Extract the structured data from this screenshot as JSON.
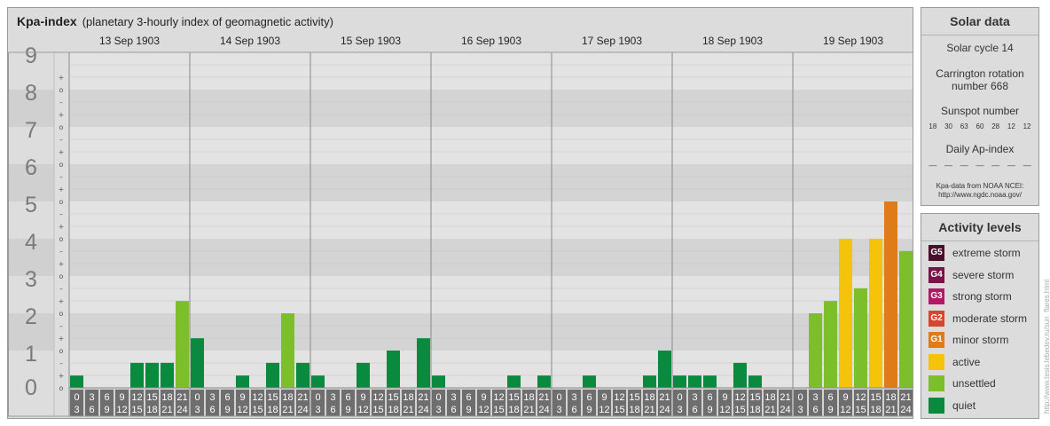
{
  "header": {
    "title": "Kpa-index",
    "subtitle": "(planetary 3-hourly index of geomagnetic activity)"
  },
  "chart_data": {
    "type": "bar",
    "title": "Kpa-index",
    "subtitle": "(planetary 3-hourly index of geomagnetic activity)",
    "ylim": [
      0,
      9
    ],
    "y_tick_labels": [
      "0",
      "1",
      "2",
      "3",
      "4",
      "5",
      "6",
      "7",
      "8",
      "9"
    ],
    "y_minor_labels": [
      "o",
      "+",
      "–"
    ],
    "days": [
      "13 Sep 1903",
      "14 Sep 1903",
      "15 Sep 1903",
      "16 Sep 1903",
      "17 Sep 1903",
      "18 Sep 1903",
      "19 Sep 1903"
    ],
    "interval_labels": [
      [
        "0",
        "3"
      ],
      [
        "3",
        "6"
      ],
      [
        "6",
        "9"
      ],
      [
        "9",
        "12"
      ],
      [
        "12",
        "15"
      ],
      [
        "15",
        "18"
      ],
      [
        "18",
        "21"
      ],
      [
        "21",
        "24"
      ]
    ],
    "values": [
      [
        0.33,
        0,
        0,
        0,
        0.67,
        0.67,
        0.67,
        2.33
      ],
      [
        1.33,
        0,
        0,
        0.33,
        0,
        0.67,
        2.0,
        0.67
      ],
      [
        0.33,
        0,
        0,
        0.67,
        0,
        1.0,
        0,
        1.33
      ],
      [
        0.33,
        0,
        0,
        0,
        0,
        0.33,
        0,
        0.33
      ],
      [
        0,
        0,
        0.33,
        0,
        0,
        0,
        0.33,
        1.0
      ],
      [
        0.33,
        0.33,
        0.33,
        0,
        0.67,
        0.33,
        0,
        0
      ],
      [
        0,
        2.0,
        2.33,
        4.0,
        2.67,
        4.0,
        5.0,
        3.67
      ]
    ],
    "colors": {
      "quiet": "#0a8a3e",
      "unsettled": "#7cbf2a",
      "active": "#f5c40a",
      "minor": "#e07b1a"
    }
  },
  "solar": {
    "heading": "Solar data",
    "cycle": "Solar cycle 14",
    "carrington_line1": "Carrington rotation",
    "carrington_line2": "number 668",
    "sunspot_heading": "Sunspot number",
    "sunspots": [
      "18",
      "30",
      "63",
      "60",
      "28",
      "12",
      "12"
    ],
    "ap_heading": "Daily Ap-index",
    "ap_values": [
      "—",
      "—",
      "—",
      "—",
      "—",
      "—",
      "—"
    ],
    "source_line1": "Kpa-data from NOAA NCEI:",
    "source_line2": "http://www.ngdc.noaa.gov/"
  },
  "activity": {
    "heading": "Activity levels",
    "levels": [
      {
        "badge": "G5",
        "label": "extreme storm",
        "color": "#4a0f2a"
      },
      {
        "badge": "G4",
        "label": "severe storm",
        "color": "#7a1348"
      },
      {
        "badge": "G3",
        "label": "strong storm",
        "color": "#b01a63"
      },
      {
        "badge": "G2",
        "label": "moderate storm",
        "color": "#d9452b"
      },
      {
        "badge": "G1",
        "label": "minor storm",
        "color": "#e07b1a"
      },
      {
        "badge": "",
        "label": "active",
        "color": "#f5c40a"
      },
      {
        "badge": "",
        "label": "unsettled",
        "color": "#7cbf2a"
      },
      {
        "badge": "",
        "label": "quiet",
        "color": "#0a8a3e"
      }
    ]
  },
  "credit": "http://www.tesis.lebedev.ru/sun_flares.html"
}
